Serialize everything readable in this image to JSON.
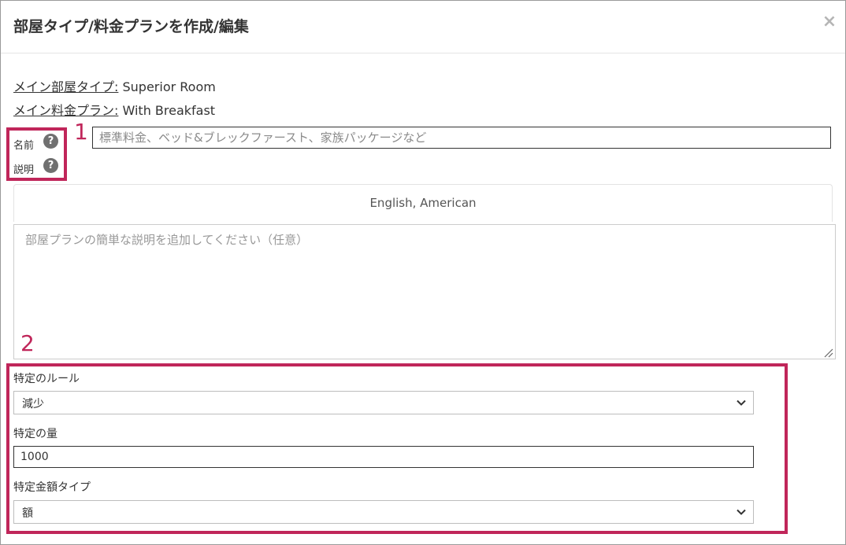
{
  "dialog": {
    "title": "部屋タイプ/料金プランを作成/編集",
    "close_label": "×"
  },
  "info": {
    "room_type_label": "メイン部屋タイプ:",
    "room_type_value": "Superior Room",
    "rate_plan_label": "メイン料金プラン:",
    "rate_plan_value": "With Breakfast"
  },
  "form": {
    "name_label": "名前",
    "description_label": "説明",
    "help_glyph": "?",
    "name_placeholder": "標準料金、ベッド&ブレックファースト、家族パッケージなど",
    "language_tab": "English, American",
    "description_placeholder": "部屋プランの簡単な説明を追加してください（任意）",
    "rule_label": "特定のルール",
    "rule_value": "減少",
    "amount_label": "特定の量",
    "amount_value": "1000",
    "amount_type_label": "特定金額タイプ",
    "amount_type_value": "額"
  },
  "annotations": {
    "marker_1": "1",
    "marker_2": "2",
    "color": "#c0265a"
  },
  "icons": [
    "close-icon",
    "help-icon",
    "chevron-down-icon",
    "resize-grip-icon"
  ]
}
